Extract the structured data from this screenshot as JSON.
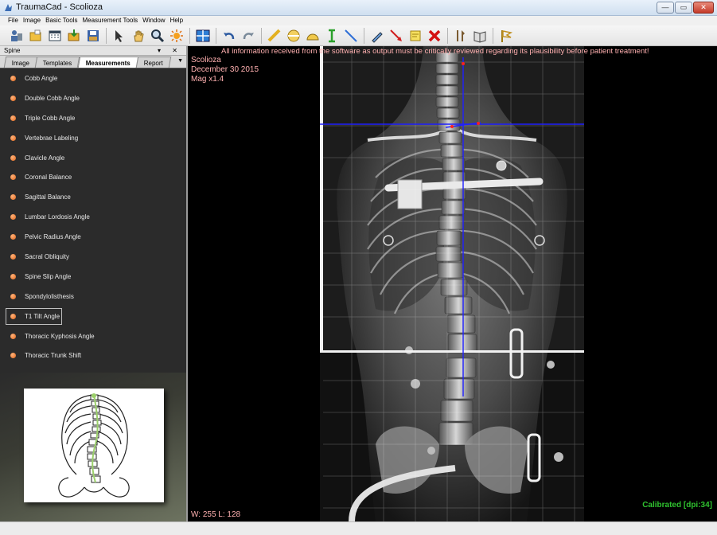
{
  "window": {
    "title": "TraumaCad - Scolioza",
    "controls": {
      "minimize": "—",
      "maximize": "▭",
      "close": "✕"
    }
  },
  "menu": [
    "File",
    "Image",
    "Basic Tools",
    "Measurement Tools",
    "Window",
    "Help"
  ],
  "toolbar": {
    "icons": [
      "patient-icon",
      "open-folder-icon",
      "calendar-icon",
      "import-icon",
      "save-icon",
      "pointer-icon",
      "pan-hand-icon",
      "zoom-icon",
      "brightness-icon",
      "layout-icon",
      "undo-icon",
      "redo-icon",
      "ruler-icon",
      "circle-icon",
      "protractor-icon",
      "caliper-icon",
      "line-icon",
      "pencil-icon",
      "arrow-icon",
      "note-icon",
      "delete-icon",
      "tools-icon",
      "book-icon",
      "flag-icon"
    ]
  },
  "panel": {
    "title": "Spine",
    "controls": "▾ ✕",
    "tabs": [
      "Image",
      "Templates",
      "Measurements",
      "Report"
    ],
    "active_tab": "Measurements",
    "measurements": [
      "Cobb Angle",
      "Double Cobb Angle",
      "Triple Cobb Angle",
      "Vertebrae Labeling",
      "Clavicle Angle",
      "Coronal Balance",
      "Sagittal Balance",
      "Lumbar Lordosis Angle",
      "Pelvic Radius Angle",
      "Sacral Obliquity",
      "Spine Slip Angle",
      "Spondylolisthesis",
      "T1 Tilt Angle",
      "Thoracic Kyphosis Angle",
      "Thoracic Trunk Shift"
    ],
    "selected": "T1 Tilt Angle"
  },
  "viewer": {
    "warning": "All information received from the software as output must be critically reviewed regarding its plausibility before patient treatment!",
    "study_name": "Scolioza",
    "study_date": "December 30 2015",
    "magnification": "Mag x1.4",
    "window_level": "W: 255 L: 128",
    "calibration": "Calibrated [dpi:34]",
    "colors": {
      "overlay_text": "#ffb0b0",
      "calibration": "#2fc22f",
      "measurement_line": "#2020ff",
      "marker": "#ff2020"
    }
  }
}
